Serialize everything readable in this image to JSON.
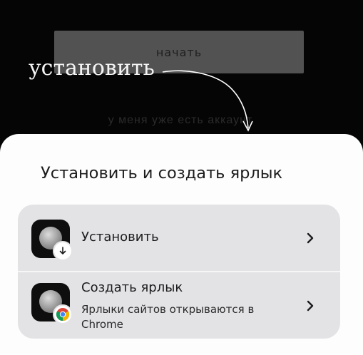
{
  "background": {
    "start_button_label": "начать",
    "have_account_label": "у меня уже есть аккаунт",
    "annotation": "установить"
  },
  "sheet": {
    "title": "Установить и создать ярлык",
    "options": [
      {
        "label": "Установить",
        "icon": "app-icon",
        "badge_icon": "download-icon"
      },
      {
        "label": "Создать ярлык",
        "sublabel": "Ярлыки сайтов открываются в Chrome",
        "icon": "app-icon",
        "badge_icon": "chrome-icon"
      }
    ]
  },
  "colors": {
    "background": "#050505",
    "sheet": "#fdfdfd",
    "option_card": "#e3e3e6",
    "text_primary": "#1c1c1c",
    "annotation": "#f4f4f4"
  }
}
